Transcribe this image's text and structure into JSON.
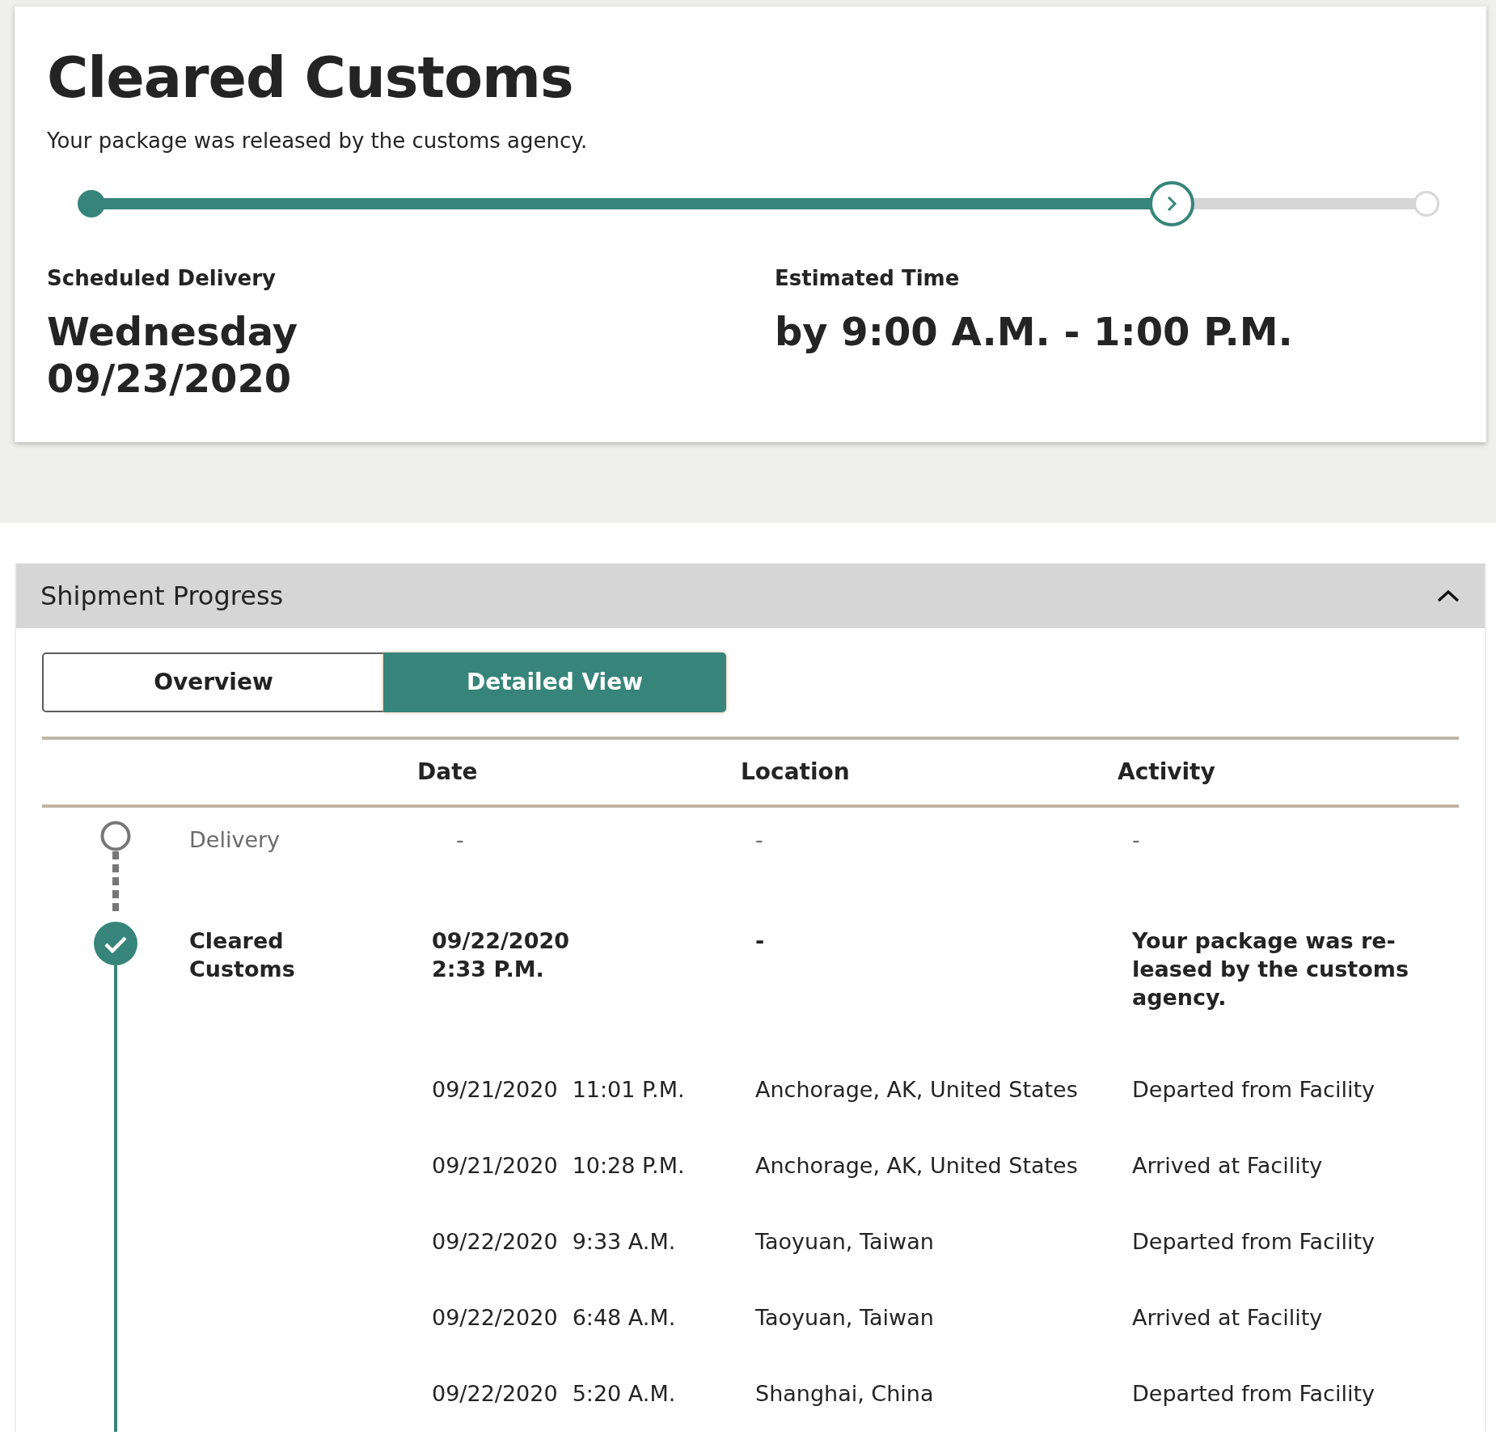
{
  "status": {
    "title": "Cleared Customs",
    "description": "Your package was released by the customs agency.",
    "progress": {
      "level": 0.81
    }
  },
  "delivery": {
    "scheduled_label": "Scheduled Delivery",
    "scheduled_day": "Wednesday",
    "scheduled_date": "09/23/2020",
    "estimated_label": "Estimated Time",
    "estimated_value": "by 9:00 A.M. - 1:00 P.M."
  },
  "shipment_progress": {
    "title": "Shipment Progress",
    "expanded": true,
    "tabs": [
      {
        "label": "Overview",
        "selected": false
      },
      {
        "label": "Detailed View",
        "selected": true
      }
    ],
    "columns": [
      "Date",
      "Location",
      "Activity"
    ],
    "milestones": [
      {
        "status": "Delivery",
        "completed": false,
        "date": "-",
        "location": "-",
        "activity": "-"
      },
      {
        "status": "Cleared Customs",
        "completed": true,
        "date": "09/22/2020",
        "time": "2:33 P.M.",
        "location": "-",
        "activity": "Your package was re-leased by the customs agency.",
        "events": [
          {
            "date": "09/21/2020",
            "time": "11:01 P.M.",
            "location": "Anchorage, AK, United States",
            "activity": "Departed from Facility"
          },
          {
            "date": "09/21/2020",
            "time": "10:28 P.M.",
            "location": "Anchorage, AK, United States",
            "activity": "Arrived at Facility"
          },
          {
            "date": "09/22/2020",
            "time": "9:33 A.M.",
            "location": "Taoyuan, Taiwan",
            "activity": "Departed from Facility"
          },
          {
            "date": "09/22/2020",
            "time": "6:48 A.M.",
            "location": "Taoyuan, Taiwan",
            "activity": "Arrived at Facility"
          },
          {
            "date": "09/22/2020",
            "time": "5:20 A.M.",
            "location": "Shanghai, China",
            "activity": "Departed from Facility"
          }
        ]
      }
    ]
  }
}
